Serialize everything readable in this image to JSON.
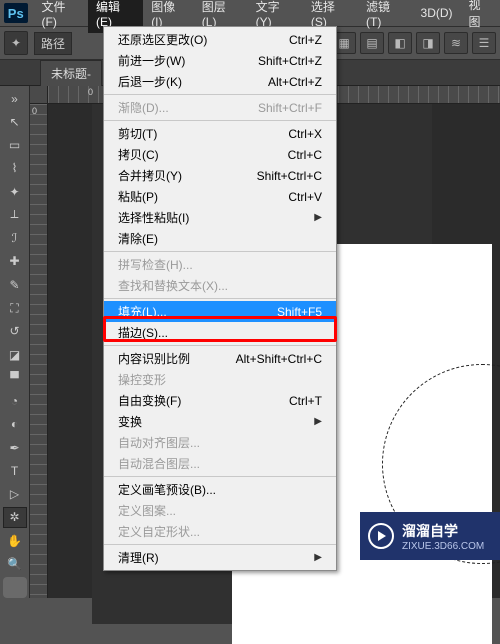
{
  "app": {
    "logo": "Ps"
  },
  "menubar": {
    "file": "文件(F)",
    "edit": "编辑(E)",
    "image": "图像(I)",
    "layer": "图层(L)",
    "type": "文字(Y)",
    "select": "选择(S)",
    "filter": "滤镜(T)",
    "threeD": "3D(D)",
    "view": "视图"
  },
  "optbar": {
    "label": "路径"
  },
  "tabs": {
    "doc1": "未标题-"
  },
  "ruler": {
    "h0": "0",
    "v0": "0"
  },
  "menu": {
    "undo": {
      "label": "还原选区更改(O)",
      "sc": "Ctrl+Z"
    },
    "stepFwd": {
      "label": "前进一步(W)",
      "sc": "Shift+Ctrl+Z"
    },
    "stepBack": {
      "label": "后退一步(K)",
      "sc": "Alt+Ctrl+Z"
    },
    "fade": {
      "label": "渐隐(D)...",
      "sc": "Shift+Ctrl+F"
    },
    "cut": {
      "label": "剪切(T)",
      "sc": "Ctrl+X"
    },
    "copy": {
      "label": "拷贝(C)",
      "sc": "Ctrl+C"
    },
    "copyMerged": {
      "label": "合并拷贝(Y)",
      "sc": "Shift+Ctrl+C"
    },
    "paste": {
      "label": "粘贴(P)",
      "sc": "Ctrl+V"
    },
    "pasteSpecial": {
      "label": "选择性粘贴(I)",
      "arrow": true
    },
    "clear": {
      "label": "清除(E)"
    },
    "spell": {
      "label": "拼写检查(H)..."
    },
    "findReplace": {
      "label": "查找和替换文本(X)..."
    },
    "fill": {
      "label": "填充(L)...",
      "sc": "Shift+F5"
    },
    "stroke": {
      "label": "描边(S)..."
    },
    "contentAware": {
      "label": "内容识别比例",
      "sc": "Alt+Shift+Ctrl+C"
    },
    "puppet": {
      "label": "操控变形"
    },
    "freeTrans": {
      "label": "自由变换(F)",
      "sc": "Ctrl+T"
    },
    "transform": {
      "label": "变换",
      "arrow": true
    },
    "autoAlign": {
      "label": "自动对齐图层..."
    },
    "autoBlend": {
      "label": "自动混合图层..."
    },
    "defineBrush": {
      "label": "定义画笔预设(B)..."
    },
    "definePattern": {
      "label": "定义图案..."
    },
    "defineShape": {
      "label": "定义自定形状..."
    },
    "purge": {
      "label": "清理(R)",
      "arrow": true
    }
  },
  "watermark": {
    "brand": "溜溜自学",
    "site": "ZIXUE.3D66.COM"
  }
}
